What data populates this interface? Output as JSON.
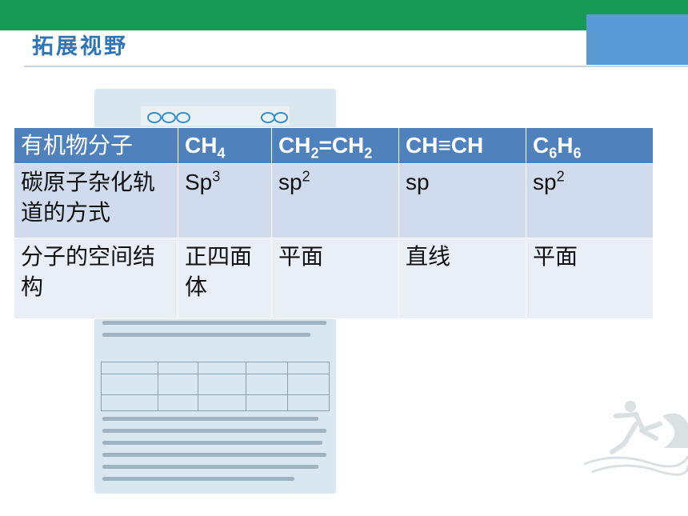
{
  "header": {
    "title": "拓展视野"
  },
  "table": {
    "columns": [
      "有机物分子",
      "CH4",
      "CH2=CH2",
      "CH≡CH",
      "C6H6"
    ],
    "rows": [
      {
        "label": "碳原子杂化轨道的方式",
        "cells": [
          "Sp3",
          "sp2",
          "sp",
          "sp2"
        ]
      },
      {
        "label": "分子的空间结构",
        "cells": [
          "正四面体",
          "平面",
          "直线",
          "平面"
        ]
      }
    ]
  },
  "colors": {
    "top_bar": "#169a55",
    "accent_box": "#5b9bd5",
    "header_row": "#4f81bd",
    "row_1": "#d0dbed",
    "row_2": "#e9eef7",
    "title": "#2e75b6"
  }
}
